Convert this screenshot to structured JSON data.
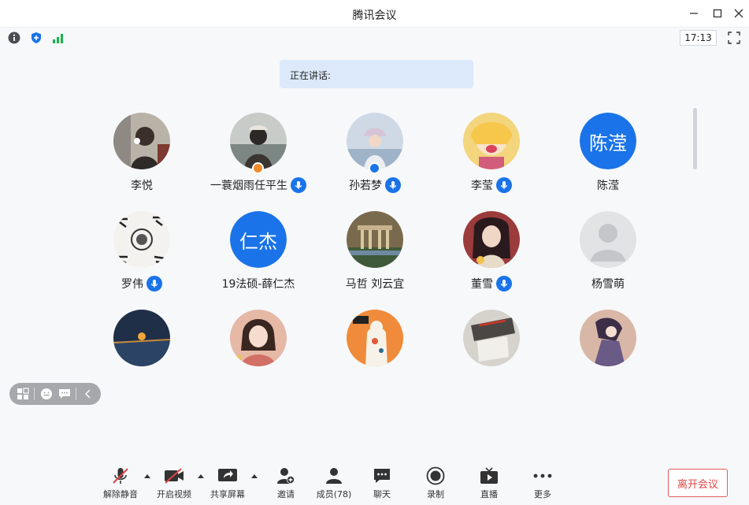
{
  "window": {
    "title": "腾讯会议",
    "controls": [
      "minimize-icon",
      "maximize-icon",
      "close-icon"
    ]
  },
  "status_bar": {
    "icons": [
      "info-icon",
      "shield-icon",
      "signal-icon"
    ],
    "clock": "17:13",
    "fullscreen_icon": "fullscreen-icon"
  },
  "speaking": {
    "label": "正在讲话:"
  },
  "participants": [
    {
      "name": "李悦",
      "avatar": "photo",
      "mic": false
    },
    {
      "name": "一蓑烟雨任平生",
      "avatar": "photo",
      "mic": true,
      "role_badge": "host-icon"
    },
    {
      "name": "孙若梦",
      "avatar": "photo",
      "mic": true,
      "role_badge": "cohost-icon"
    },
    {
      "name": "李莹",
      "avatar": "photo",
      "mic": true
    },
    {
      "name": "陈滢",
      "avatar_text": "陈滢",
      "mic": false
    },
    {
      "name": "罗伟",
      "avatar": "photo",
      "mic": true
    },
    {
      "name": "19法硕-薛仁杰",
      "avatar_text": "仁杰",
      "mic": false
    },
    {
      "name": "马哲 刘云宜",
      "avatar": "photo",
      "mic": false
    },
    {
      "name": "董雪",
      "avatar": "photo",
      "mic": true
    },
    {
      "name": "杨雪萌",
      "avatar": "default",
      "mic": false
    },
    {
      "name": "",
      "avatar": "photo",
      "mic": false
    },
    {
      "name": "",
      "avatar": "photo",
      "mic": false
    },
    {
      "name": "",
      "avatar": "photo",
      "mic": false
    },
    {
      "name": "",
      "avatar": "photo",
      "mic": false
    },
    {
      "name": "",
      "avatar": "photo",
      "mic": false
    }
  ],
  "floating_bar": {
    "icons": [
      "layout-icon",
      "emoji-icon",
      "chat-bubble-icon",
      "collapse-icon"
    ]
  },
  "toolbar": {
    "unmute": "解除静音",
    "start_video": "开启视频",
    "share_screen": "共享屏幕",
    "invite": "邀请",
    "members": "成员(78)",
    "chat": "聊天",
    "record": "录制",
    "live": "直播",
    "more": "更多",
    "leave": "离开会议"
  },
  "colors": {
    "accent": "#1a73e8",
    "danger": "#e04545",
    "speaking_bg": "#dbe9fb"
  }
}
